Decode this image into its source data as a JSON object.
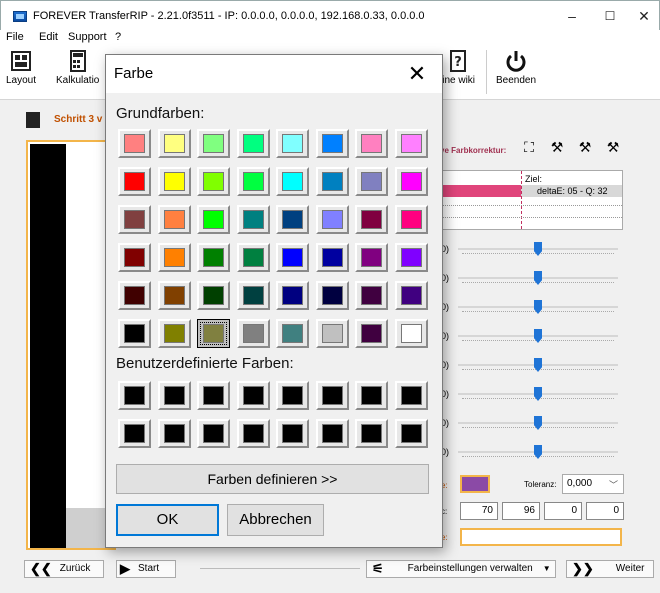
{
  "window": {
    "title": "FOREVER TransferRIP - 2.21.0f3511 - IP: 0.0.0.0, 0.0.0.0, 192.168.0.33, 0.0.0.0",
    "minimize": "–",
    "maximize": "☐",
    "close": "✕"
  },
  "menu": [
    "File",
    "Edit",
    "Support",
    "?"
  ],
  "toolbar": {
    "layout": "Layout",
    "kalkulation": "Kalkulatio",
    "wiki": "line wiki",
    "beenden": "Beenden"
  },
  "step": {
    "label": "Schritt 3 v"
  },
  "farbkorrektur": {
    "label": "ve Farbkorrektur:",
    "ziel_header": "Ziel:",
    "delta": "deltaE: 05 - Q: 32",
    "ziel_color": "#e0457b"
  },
  "sliders": [
    0.5,
    0.5,
    0.5,
    0.5,
    0.5,
    0.5,
    0.5,
    0.5
  ],
  "slider_marks": [
    "0)",
    "0)",
    "0)",
    "0)",
    "0)",
    "0)",
    "0)",
    "0)"
  ],
  "color_row": {
    "label": "e:",
    "swatch_color": "#8b4aa6",
    "toleranz_label": "Toleranz:",
    "toleranz_value": "0,000"
  },
  "cmyk_row": {
    "label": "c:",
    "values": [
      "70",
      "96",
      "0",
      "0"
    ]
  },
  "orange_row": {
    "label": "e:"
  },
  "nav": {
    "back": "Zurück",
    "start": "Start",
    "manage": "Farbeinstellungen verwalten",
    "next": "Weiter"
  },
  "dialog": {
    "title": "Farbe",
    "close": "✕",
    "basic_label": "Grundfarben:",
    "custom_label": "Benutzerdefinierte Farben:",
    "define_button": "Farben definieren >>",
    "ok_button": "OK",
    "cancel_button": "Abbrechen",
    "basic_colors": [
      [
        "#ff8080",
        "#ffff80",
        "#80ff80",
        "#00ff80",
        "#80ffff",
        "#0080ff",
        "#ff80c0",
        "#ff80ff"
      ],
      [
        "#ff0000",
        "#ffff00",
        "#80ff00",
        "#00ff40",
        "#00ffff",
        "#0080c0",
        "#8080c0",
        "#ff00ff"
      ],
      [
        "#804040",
        "#ff8040",
        "#00ff00",
        "#008080",
        "#004080",
        "#8080ff",
        "#800040",
        "#ff0080"
      ],
      [
        "#800000",
        "#ff8000",
        "#008000",
        "#008040",
        "#0000ff",
        "#0000a0",
        "#800080",
        "#8000ff"
      ],
      [
        "#400000",
        "#804000",
        "#004000",
        "#004040",
        "#000080",
        "#000040",
        "#400040",
        "#400080"
      ],
      [
        "#000000",
        "#808000",
        "#808040",
        "#808080",
        "#408080",
        "#c0c0c0",
        "#400040",
        "#ffffff"
      ]
    ],
    "selected": [
      5,
      2
    ],
    "custom_colors": [
      [
        "#000000",
        "#000000",
        "#000000",
        "#000000",
        "#000000",
        "#000000",
        "#000000",
        "#000000"
      ],
      [
        "#000000",
        "#000000",
        "#000000",
        "#000000",
        "#000000",
        "#000000",
        "#000000",
        "#000000"
      ]
    ]
  }
}
